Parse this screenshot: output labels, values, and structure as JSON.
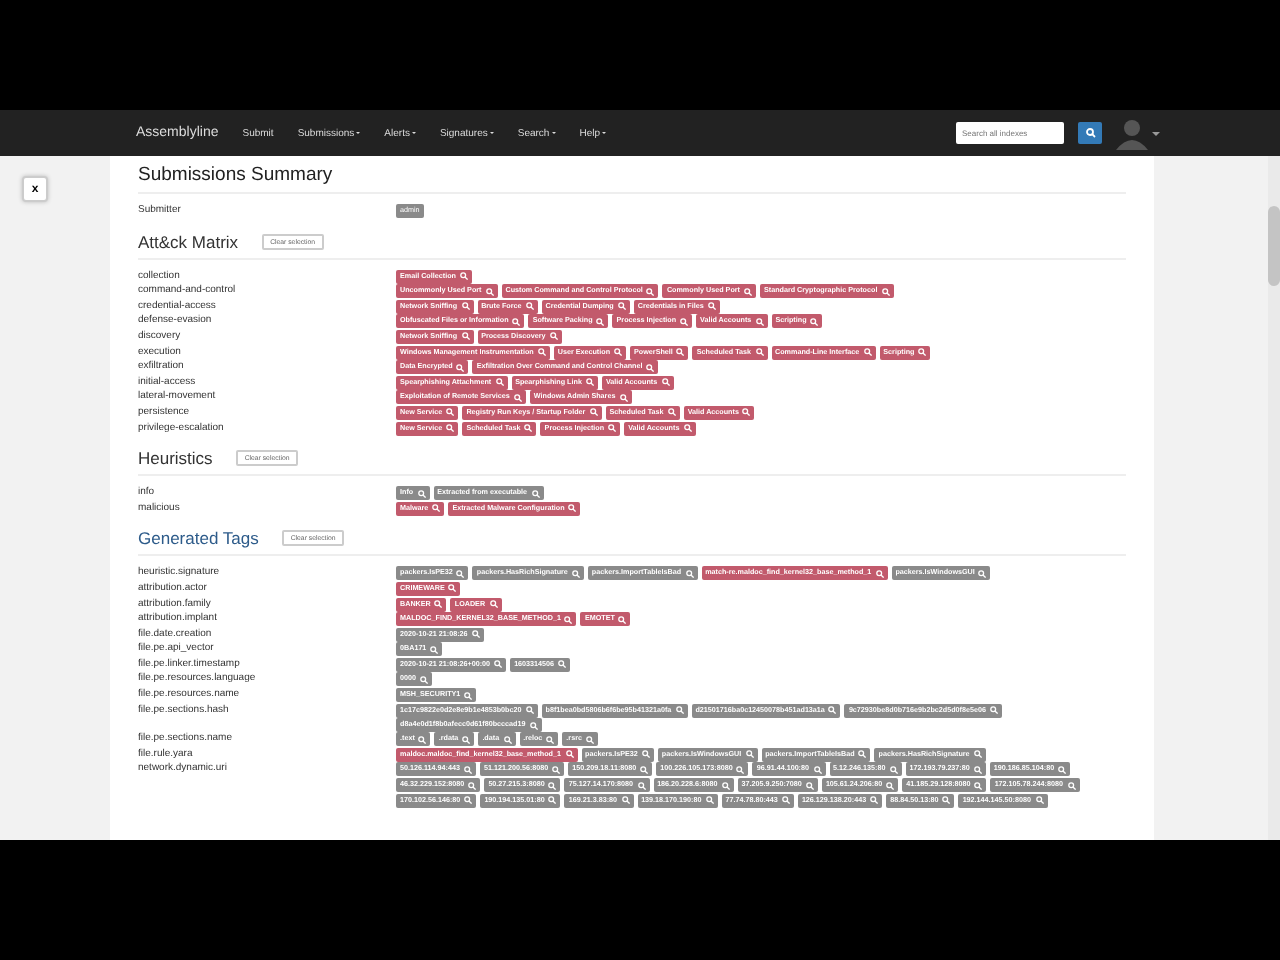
{
  "navbar": {
    "brand": "Assemblyline",
    "items": [
      {
        "label": "Submit",
        "dropdown": false
      },
      {
        "label": "Submissions",
        "dropdown": true
      },
      {
        "label": "Alerts",
        "dropdown": true
      },
      {
        "label": "Signatures",
        "dropdown": true
      },
      {
        "label": "Search",
        "dropdown": true
      },
      {
        "label": "Help",
        "dropdown": true
      }
    ],
    "search": {
      "placeholder": "Search all indexes"
    }
  },
  "close_button": "x",
  "title": "Submissions Summary",
  "submitter": {
    "label": "Submitter",
    "value": "admin"
  },
  "sections": [
    {
      "title": "Att&ck Matrix",
      "accent": false,
      "clear": "Clear selection",
      "rows": [
        {
          "label": "collection",
          "tags": [
            {
              "text": "Email Collection",
              "color": "#c25a6c"
            }
          ]
        },
        {
          "label": "command-and-control",
          "tags": [
            {
              "text": "Uncommonly Used Port",
              "color": "#c25a6c"
            },
            {
              "text": "Custom Command and Control Protocol",
              "color": "#c25a6c"
            },
            {
              "text": "Commonly Used Port",
              "color": "#c25a6c"
            },
            {
              "text": "Standard Cryptographic Protocol",
              "color": "#c25a6c"
            }
          ]
        },
        {
          "label": "credential-access",
          "tags": [
            {
              "text": "Network Sniffing",
              "color": "#c25a6c"
            },
            {
              "text": "Brute Force",
              "color": "#c25a6c"
            },
            {
              "text": "Credential Dumping",
              "color": "#c25a6c"
            },
            {
              "text": "Credentials in Files",
              "color": "#c25a6c"
            }
          ]
        },
        {
          "label": "defense-evasion",
          "tags": [
            {
              "text": "Obfuscated Files or Information",
              "color": "#c25a6c"
            },
            {
              "text": "Software Packing",
              "color": "#c25a6c"
            },
            {
              "text": "Process Injection",
              "color": "#c25a6c"
            },
            {
              "text": "Valid Accounts",
              "color": "#c25a6c"
            },
            {
              "text": "Scripting",
              "color": "#c25a6c"
            }
          ]
        },
        {
          "label": "discovery",
          "tags": [
            {
              "text": "Network Sniffing",
              "color": "#c25a6c"
            },
            {
              "text": "Process Discovery",
              "color": "#c25a6c"
            }
          ]
        },
        {
          "label": "execution",
          "tags": [
            {
              "text": "Windows Management Instrumentation",
              "color": "#c25a6c"
            },
            {
              "text": "User Execution",
              "color": "#c25a6c"
            },
            {
              "text": "PowerShell",
              "color": "#c25a6c"
            },
            {
              "text": "Scheduled Task",
              "color": "#c25a6c"
            },
            {
              "text": "Command-Line Interface",
              "color": "#c25a6c"
            },
            {
              "text": "Scripting",
              "color": "#c25a6c"
            }
          ]
        },
        {
          "label": "exfiltration",
          "tags": [
            {
              "text": "Data Encrypted",
              "color": "#c25a6c"
            },
            {
              "text": "Exfiltration Over Command and Control Channel",
              "color": "#c25a6c"
            }
          ]
        },
        {
          "label": "initial-access",
          "tags": [
            {
              "text": "Spearphishing Attachment",
              "color": "#c25a6c"
            },
            {
              "text": "Spearphishing Link",
              "color": "#c25a6c"
            },
            {
              "text": "Valid Accounts",
              "color": "#c25a6c"
            }
          ]
        },
        {
          "label": "lateral-movement",
          "tags": [
            {
              "text": "Exploitation of Remote Services",
              "color": "#c25a6c"
            },
            {
              "text": "Windows Admin Shares",
              "color": "#c25a6c"
            }
          ]
        },
        {
          "label": "persistence",
          "tags": [
            {
              "text": "New Service",
              "color": "#c25a6c"
            },
            {
              "text": "Registry Run Keys / Startup Folder",
              "color": "#c25a6c"
            },
            {
              "text": "Scheduled Task",
              "color": "#c25a6c"
            },
            {
              "text": "Valid Accounts",
              "color": "#c25a6c"
            }
          ]
        },
        {
          "label": "privilege-escalation",
          "tags": [
            {
              "text": "New Service",
              "color": "#c25a6c"
            },
            {
              "text": "Scheduled Task",
              "color": "#c25a6c"
            },
            {
              "text": "Process Injection",
              "color": "#c25a6c"
            },
            {
              "text": "Valid Accounts",
              "color": "#c25a6c"
            }
          ]
        }
      ]
    },
    {
      "title": "Heuristics",
      "accent": false,
      "clear": "Clear selection",
      "rows": [
        {
          "label": "info",
          "tags": [
            {
              "text": "Info",
              "color": "#8a8a8a"
            },
            {
              "text": "Extracted from executable",
              "color": "#8a8a8a"
            }
          ]
        },
        {
          "label": "malicious",
          "tags": [
            {
              "text": "Malware",
              "color": "#c25a6c"
            },
            {
              "text": "Extracted Malware Configuration",
              "color": "#c25a6c"
            }
          ]
        }
      ]
    },
    {
      "title": "Generated Tags",
      "accent": true,
      "clear": "Clear selection",
      "rows": [
        {
          "label": "heuristic.signature",
          "tags": [
            {
              "text": "packers.IsPE32",
              "color": "#8a8a8a"
            },
            {
              "text": "packers.HasRichSignature",
              "color": "#8a8a8a"
            },
            {
              "text": "packers.ImportTableIsBad",
              "color": "#8a8a8a"
            },
            {
              "text": "match-re.maldoc_find_kernel32_base_method_1",
              "color": "#c25a6c"
            },
            {
              "text": "packers.IsWindowsGUI",
              "color": "#8a8a8a"
            }
          ]
        },
        {
          "label": "attribution.actor",
          "tags": [
            {
              "text": "CRIMEWARE",
              "color": "#c25a6c"
            }
          ]
        },
        {
          "label": "attribution.family",
          "tags": [
            {
              "text": "BANKER",
              "color": "#c25a6c"
            },
            {
              "text": "LOADER",
              "color": "#c25a6c"
            }
          ]
        },
        {
          "label": "attribution.implant",
          "tags": [
            {
              "text": "MALDOC_FIND_KERNEL32_BASE_METHOD_1",
              "color": "#c25a6c"
            },
            {
              "text": "EMOTET",
              "color": "#c25a6c"
            }
          ]
        },
        {
          "label": "file.date.creation",
          "tags": [
            {
              "text": "2020-10-21 21:08:26",
              "color": "#8a8a8a"
            }
          ]
        },
        {
          "label": "file.pe.api_vector",
          "tags": [
            {
              "text": "0BA171",
              "color": "#8a8a8a"
            }
          ]
        },
        {
          "label": "file.pe.linker.timestamp",
          "tags": [
            {
              "text": "2020-10-21 21:08:26+00:00",
              "color": "#8a8a8a"
            },
            {
              "text": "1603314506",
              "color": "#8a8a8a"
            }
          ]
        },
        {
          "label": "file.pe.resources.language",
          "tags": [
            {
              "text": "0000",
              "color": "#8a8a8a"
            }
          ]
        },
        {
          "label": "file.pe.resources.name",
          "tags": [
            {
              "text": "MSH_SECURITY1",
              "color": "#8a8a8a"
            }
          ]
        },
        {
          "label": "file.pe.sections.hash",
          "tags": [
            {
              "text": "1c17c9822e0d2e8e9b1e4853b0bc20",
              "color": "#8a8a8a"
            },
            {
              "text": "b8f1bea0bd5806b6f6be95b41321a0fa",
              "color": "#8a8a8a"
            },
            {
              "text": "d21501716ba0c12450078b451ad13a1a",
              "color": "#8a8a8a"
            },
            {
              "text": "9c72930be8d0b716e9b2bc2d5d0f8e5e06",
              "color": "#8a8a8a"
            },
            {
              "text": "d8a4e0d1f8b0afecc0d61f80bcccad19",
              "color": "#8a8a8a"
            }
          ]
        },
        {
          "label": "file.pe.sections.name",
          "tags": [
            {
              "text": ".text",
              "color": "#8a8a8a"
            },
            {
              "text": ".rdata",
              "color": "#8a8a8a"
            },
            {
              "text": ".data",
              "color": "#8a8a8a"
            },
            {
              "text": ".reloc",
              "color": "#8a8a8a"
            },
            {
              "text": ".rsrc",
              "color": "#8a8a8a"
            }
          ]
        },
        {
          "label": "file.rule.yara",
          "tags": [
            {
              "text": "maldoc.maldoc_find_kernel32_base_method_1",
              "color": "#c25a6c"
            },
            {
              "text": "packers.IsPE32",
              "color": "#8a8a8a"
            },
            {
              "text": "packers.IsWindowsGUI",
              "color": "#8a8a8a"
            },
            {
              "text": "packers.ImportTableIsBad",
              "color": "#8a8a8a"
            },
            {
              "text": "packers.HasRichSignature",
              "color": "#8a8a8a"
            }
          ]
        },
        {
          "label": "network.dynamic.uri",
          "tags": [
            {
              "text": "50.126.114.94:443",
              "color": "#8a8a8a"
            },
            {
              "text": "51.121.200.56:8080",
              "color": "#8a8a8a"
            },
            {
              "text": "150.209.18.11:8080",
              "color": "#8a8a8a"
            },
            {
              "text": "100.226.105.173:8080",
              "color": "#8a8a8a"
            },
            {
              "text": "96.91.44.100:80",
              "color": "#8a8a8a"
            },
            {
              "text": "5.12.246.135:80",
              "color": "#8a8a8a"
            },
            {
              "text": "172.193.79.237:80",
              "color": "#8a8a8a"
            },
            {
              "text": "190.186.85.104:80",
              "color": "#8a8a8a"
            },
            {
              "text": "46.32.229.152:8080",
              "color": "#8a8a8a"
            },
            {
              "text": "50.27.215.3:8080",
              "color": "#8a8a8a"
            },
            {
              "text": "75.127.14.170:8080",
              "color": "#8a8a8a"
            },
            {
              "text": "186.20.228.6:8080",
              "color": "#8a8a8a"
            },
            {
              "text": "37.205.9.250:7080",
              "color": "#8a8a8a"
            },
            {
              "text": "105.61.24.206:80",
              "color": "#8a8a8a"
            },
            {
              "text": "41.185.29.128:8080",
              "color": "#8a8a8a"
            },
            {
              "text": "172.105.78.244:8080",
              "color": "#8a8a8a"
            },
            {
              "text": "170.102.56.146:80",
              "color": "#8a8a8a"
            },
            {
              "text": "190.194.135.01:80",
              "color": "#8a8a8a"
            },
            {
              "text": "169.21.3.83:80",
              "color": "#8a8a8a"
            },
            {
              "text": "139.18.170.190:80",
              "color": "#8a8a8a"
            },
            {
              "text": "77.74.78.80:443",
              "color": "#8a8a8a"
            },
            {
              "text": "126.129.138.20:443",
              "color": "#8a8a8a"
            },
            {
              "text": "88.84.50.13:80",
              "color": "#8a8a8a"
            },
            {
              "text": "192.144.145.50:8080",
              "color": "#8a8a8a"
            }
          ]
        }
      ]
    }
  ]
}
